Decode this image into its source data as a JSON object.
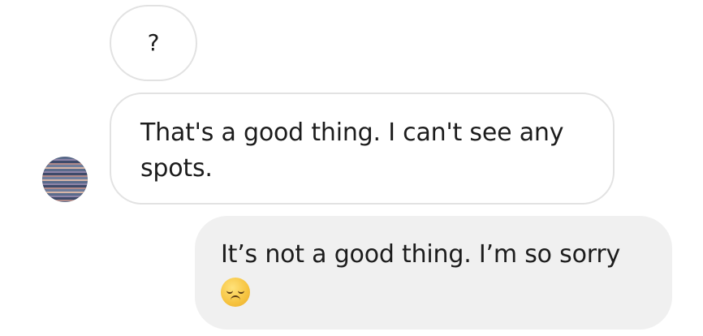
{
  "messages": [
    {
      "direction": "incoming",
      "lines": [
        "?"
      ]
    },
    {
      "direction": "incoming",
      "lines": [
        "That's a good thing. I can't see any",
        "spots."
      ]
    },
    {
      "direction": "outgoing",
      "lines": [
        "It’s not a good thing. I’m so sorry"
      ],
      "emoji": "disappointed-face-emoji"
    }
  ],
  "colors": {
    "incoming_bubble_bg": "#ffffff",
    "incoming_bubble_border": "#e2e2e2",
    "outgoing_bubble_bg": "#f0f0f0",
    "text": "#1c1c1c",
    "page_bg": "#ffffff"
  }
}
